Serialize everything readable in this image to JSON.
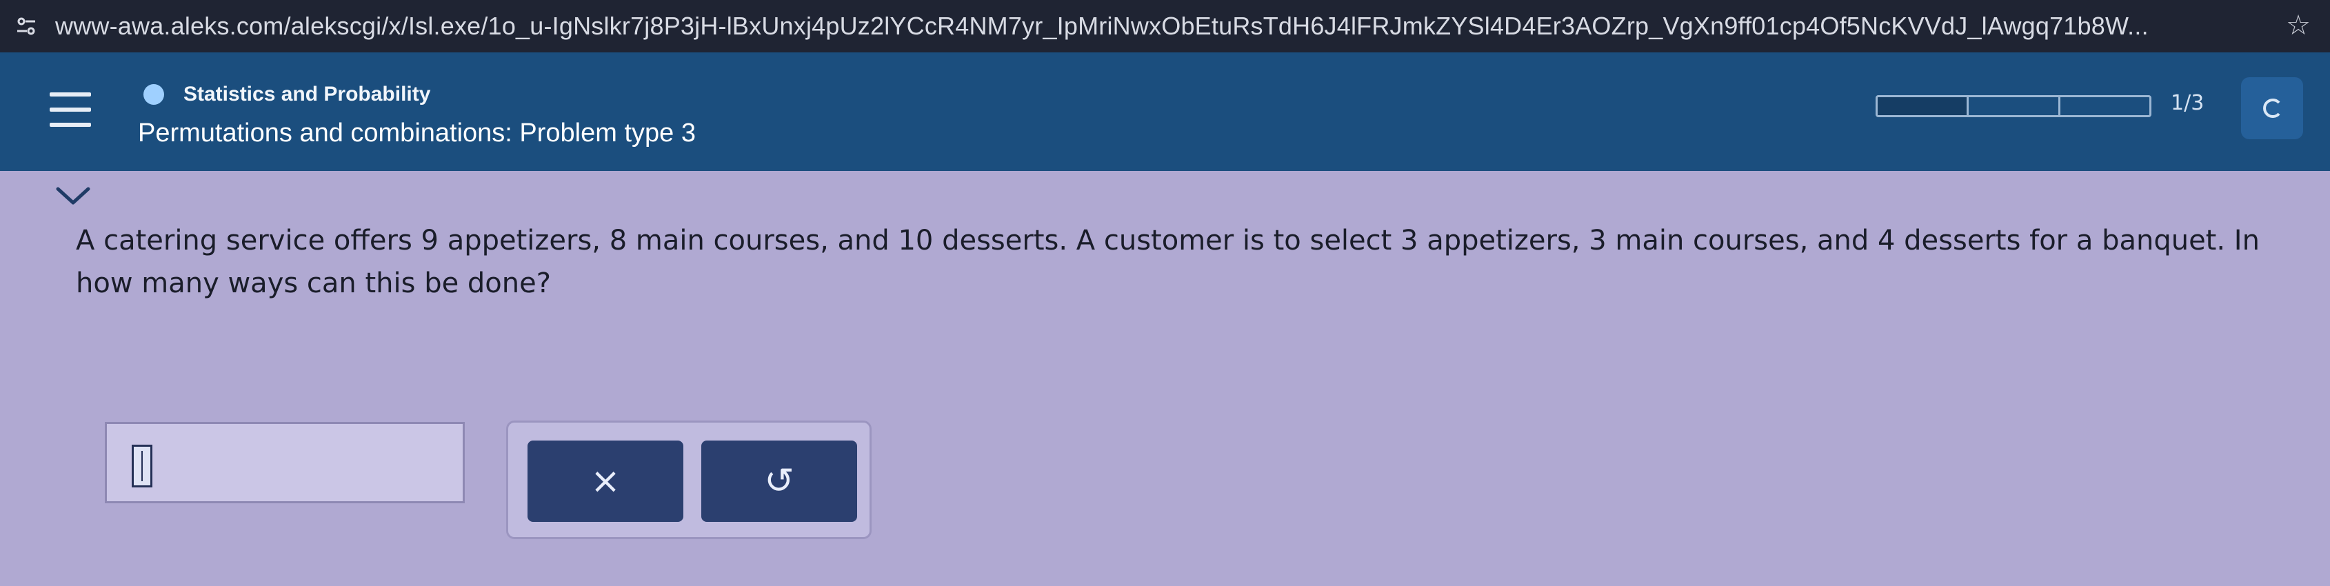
{
  "browser": {
    "url": "www-awa.aleks.com/alekscgi/x/Isl.exe/1o_u-IgNslkr7j8P3jH-lBxUnxj4pUz2lYCcR4NM7yr_IpMriNwxObEtuRsTdH6J4lFRJmkZYSl4D4Er3AOZrp_VgXn9ff01cp4Of5NcKVVdJ_lAwgq71b8W...",
    "site_icon": "site-settings-icon",
    "bookmark_icon": "star-icon"
  },
  "header": {
    "menu_icon": "hamburger-menu-icon",
    "subject": "Statistics and Probability",
    "topic_title": "Permutations and combinations: Problem type 3",
    "progress": {
      "current": 1,
      "total": 3,
      "text": "1/3"
    },
    "right_button_icon": "search-icon",
    "subject_color": "#9fd0ff",
    "header_color": "#1b4e7e"
  },
  "question": {
    "collapse_icon": "chevron-down-icon",
    "text": "A catering service offers 9 appetizers, 8 main courses, and 10 desserts. A customer is to select 3 appetizers, 3 main courses, and 4 desserts for a banquet. In how many ways can this be done?"
  },
  "answer": {
    "value": "",
    "clear_icon": "close-icon",
    "clear_symbol": "×",
    "undo_icon": "undo-icon",
    "undo_symbol": "↺"
  }
}
